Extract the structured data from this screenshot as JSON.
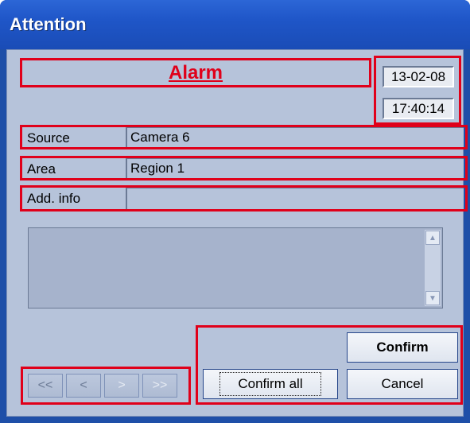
{
  "window": {
    "title": "Attention"
  },
  "alarm": {
    "label": "Alarm"
  },
  "datetime": {
    "date": "13-02-08",
    "time": "17:40:14"
  },
  "fields": [
    {
      "label": "Source",
      "value": "Camera 6"
    },
    {
      "label": "Area",
      "value": "Region 1"
    },
    {
      "label": "Add. info",
      "value": ""
    }
  ],
  "textarea": {
    "text": ""
  },
  "navigation": {
    "first": "<<",
    "prev": "<",
    "next": ">",
    "last": ">>"
  },
  "buttons": {
    "confirm": "Confirm",
    "confirm_all": "Confirm all",
    "cancel": "Cancel"
  },
  "colors": {
    "highlight_border": "#e0001a",
    "alarm_text": "#e0001a",
    "titlebar": "#1f56c8",
    "client_bg": "#b6c3da"
  },
  "icons": {
    "scroll_up": "chevron-up-icon",
    "scroll_down": "chevron-down-icon"
  }
}
